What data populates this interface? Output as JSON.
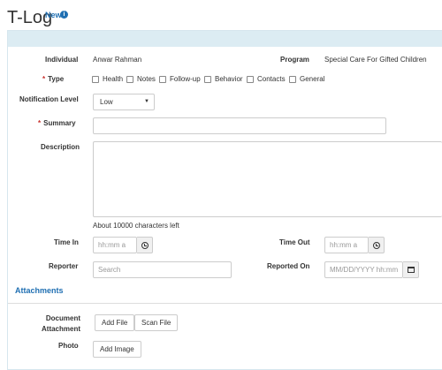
{
  "page": {
    "title": "T-Log",
    "new_label": "New",
    "info_icon": "info-icon"
  },
  "individual": {
    "label": "Individual",
    "value": "Anwar Rahman"
  },
  "program": {
    "label": "Program",
    "value": "Special Care For Gifted Children"
  },
  "type": {
    "label": "Type",
    "required_mark": "*",
    "options": [
      "Health",
      "Notes",
      "Follow-up",
      "Behavior",
      "Contacts",
      "General"
    ]
  },
  "notification": {
    "label": "Notification Level",
    "value": "Low"
  },
  "summary": {
    "label": "Summary",
    "required_mark": "*",
    "value": ""
  },
  "description": {
    "label": "Description",
    "value": "",
    "chars_left": "About 10000 characters left"
  },
  "time_in": {
    "label": "Time In",
    "placeholder": "hh:mm a"
  },
  "time_out": {
    "label": "Time Out",
    "placeholder": "hh:mm a"
  },
  "reporter": {
    "label": "Reporter",
    "placeholder": "Search"
  },
  "reported_on": {
    "label": "Reported On",
    "placeholder": "MM/DD/YYYY hh:mm"
  },
  "attachments": {
    "heading": "Attachments",
    "document_label_line1": "Document",
    "document_label_line2": "Attachment",
    "add_file": "Add File",
    "scan_file": "Scan File",
    "photo_label": "Photo",
    "add_image": "Add Image"
  },
  "colors": {
    "accent": "#1f6fb2",
    "panel_header": "#dcecf3",
    "required": "#c9302c"
  }
}
